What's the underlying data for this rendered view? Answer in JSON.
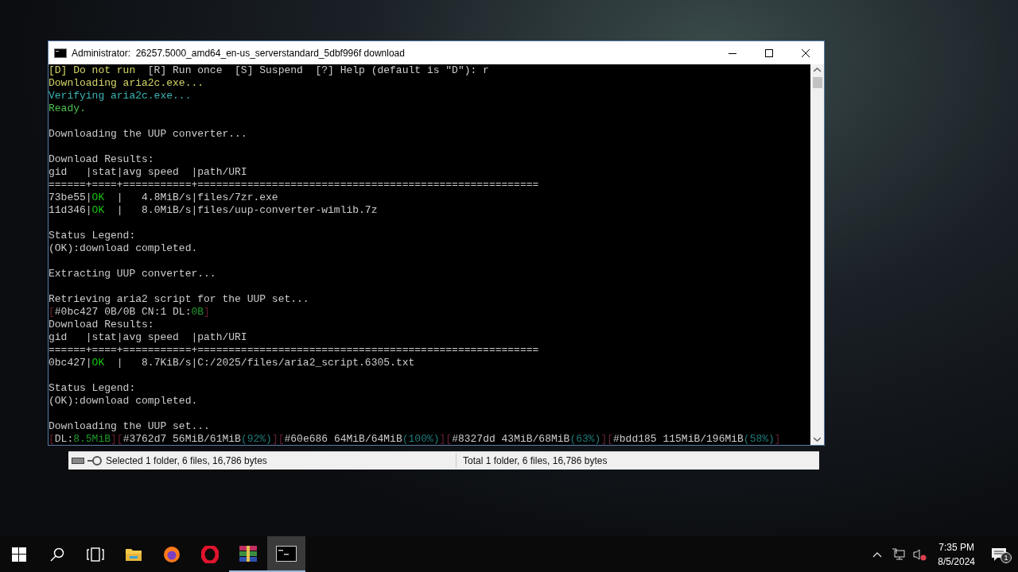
{
  "console_window": {
    "title": "Administrator:  26257.5000_amd64_en-us_serverstandard_5dbf996f download",
    "lines": [
      {
        "kind": "text",
        "segments": [
          {
            "text": "[D] Do not run",
            "color": "#d6d66a"
          },
          {
            "text": "  [R] Run once  [S] Suspend  [?] Help (default is \"D\"): r",
            "color": "#cccccc"
          }
        ]
      },
      {
        "kind": "text",
        "segments": [
          {
            "text": "Downloading aria2c.exe...",
            "color": "#d6d66a"
          }
        ]
      },
      {
        "kind": "text",
        "segments": [
          {
            "text": "Verifying aria2c.exe...",
            "color": "#3ab4b4"
          }
        ]
      },
      {
        "kind": "text",
        "segments": [
          {
            "text": "Ready.",
            "color": "#4ec24e"
          }
        ]
      },
      {
        "kind": "blank"
      },
      {
        "kind": "text",
        "segments": [
          {
            "text": "Downloading the UUP converter...",
            "color": "#cccccc"
          }
        ]
      },
      {
        "kind": "blank"
      },
      {
        "kind": "text",
        "segments": [
          {
            "text": "Download Results:",
            "color": "#cccccc"
          }
        ]
      },
      {
        "kind": "text",
        "segments": [
          {
            "text": "gid   |stat|avg speed  |path/URI",
            "color": "#cccccc"
          }
        ]
      },
      {
        "kind": "text",
        "segments": [
          {
            "text": "======+====+===========+=======================================================",
            "color": "#cccccc"
          }
        ]
      },
      {
        "kind": "text",
        "segments": [
          {
            "text": "73be55|",
            "color": "#cccccc"
          },
          {
            "text": "OK",
            "color": "#16c60c"
          },
          {
            "text": "  |   4.8MiB/s|files/7zr.exe",
            "color": "#cccccc"
          }
        ]
      },
      {
        "kind": "text",
        "segments": [
          {
            "text": "11d346|",
            "color": "#cccccc"
          },
          {
            "text": "OK",
            "color": "#16c60c"
          },
          {
            "text": "  |   8.0MiB/s|files/uup-converter-wimlib.7z",
            "color": "#cccccc"
          }
        ]
      },
      {
        "kind": "blank"
      },
      {
        "kind": "text",
        "segments": [
          {
            "text": "Status Legend:",
            "color": "#cccccc"
          }
        ]
      },
      {
        "kind": "text",
        "segments": [
          {
            "text": "(OK):download completed.",
            "color": "#cccccc"
          }
        ]
      },
      {
        "kind": "blank"
      },
      {
        "kind": "text",
        "segments": [
          {
            "text": "Extracting UUP converter...",
            "color": "#cccccc"
          }
        ]
      },
      {
        "kind": "blank"
      },
      {
        "kind": "text",
        "segments": [
          {
            "text": "Retrieving aria2 script for the UUP set...",
            "color": "#cccccc"
          }
        ]
      },
      {
        "kind": "text",
        "segments": [
          {
            "text": "[",
            "color": "#6a2030"
          },
          {
            "text": "#0bc427 0B/0B CN:1 DL:",
            "color": "#cccccc"
          },
          {
            "text": "0B",
            "color": "#1f9a2a"
          },
          {
            "text": "]",
            "color": "#6a2030"
          }
        ]
      },
      {
        "kind": "text",
        "segments": [
          {
            "text": "Download Results:",
            "color": "#cccccc"
          }
        ]
      },
      {
        "kind": "text",
        "segments": [
          {
            "text": "gid   |stat|avg speed  |path/URI",
            "color": "#cccccc"
          }
        ]
      },
      {
        "kind": "text",
        "segments": [
          {
            "text": "======+====+===========+=======================================================",
            "color": "#cccccc"
          }
        ]
      },
      {
        "kind": "text",
        "segments": [
          {
            "text": "0bc427|",
            "color": "#cccccc"
          },
          {
            "text": "OK",
            "color": "#16c60c"
          },
          {
            "text": "  |   8.7KiB/s|C:/2025/files/aria2_script.6305.txt",
            "color": "#cccccc"
          }
        ]
      },
      {
        "kind": "blank"
      },
      {
        "kind": "text",
        "segments": [
          {
            "text": "Status Legend:",
            "color": "#cccccc"
          }
        ]
      },
      {
        "kind": "text",
        "segments": [
          {
            "text": "(OK):download completed.",
            "color": "#cccccc"
          }
        ]
      },
      {
        "kind": "blank"
      },
      {
        "kind": "text",
        "segments": [
          {
            "text": "Downloading the UUP set...",
            "color": "#cccccc"
          }
        ]
      },
      {
        "kind": "text",
        "segments": [
          {
            "text": "[",
            "color": "#6a2030"
          },
          {
            "text": "DL:",
            "color": "#cccccc"
          },
          {
            "text": "8.5MiB",
            "color": "#1f9a2a"
          },
          {
            "text": "][",
            "color": "#6a2030"
          },
          {
            "text": "#3762d7 56MiB/61MiB",
            "color": "#cccccc"
          },
          {
            "text": "(92%)",
            "color": "#1f7a7a"
          },
          {
            "text": "][",
            "color": "#6a2030"
          },
          {
            "text": "#60e686 64MiB/64MiB",
            "color": "#cccccc"
          },
          {
            "text": "(100%)",
            "color": "#1f7a7a"
          },
          {
            "text": "][",
            "color": "#6a2030"
          },
          {
            "text": "#8327dd 43MiB/68MiB",
            "color": "#cccccc"
          },
          {
            "text": "(63%)",
            "color": "#1f7a7a"
          },
          {
            "text": "][",
            "color": "#6a2030"
          },
          {
            "text": "#bdd185 115MiB/196MiB",
            "color": "#cccccc"
          },
          {
            "text": "(58%)",
            "color": "#1f7a7a"
          },
          {
            "text": "]",
            "color": "#6a2030"
          }
        ]
      }
    ]
  },
  "background_window": {
    "status_bar": [
      "Selected 1 folder, 6 files, 16,786 bytes",
      "Total 1 folder, 6 files, 16,786 bytes"
    ]
  },
  "taskbar": {
    "items": [
      {
        "kind": "start",
        "open": false,
        "selected": false
      },
      {
        "kind": "search",
        "open": false,
        "selected": false
      },
      {
        "kind": "taskview",
        "open": false,
        "selected": false
      },
      {
        "kind": "folder",
        "open": false,
        "selected": false
      },
      {
        "kind": "firefox",
        "open": false,
        "selected": false
      },
      {
        "kind": "opera",
        "open": false,
        "selected": false
      },
      {
        "kind": "archive",
        "open": true,
        "selected": false
      },
      {
        "kind": "terminal",
        "open": true,
        "selected": true
      }
    ],
    "time": "7:35 PM",
    "date": "8/5/2024",
    "notification_count": "1"
  }
}
